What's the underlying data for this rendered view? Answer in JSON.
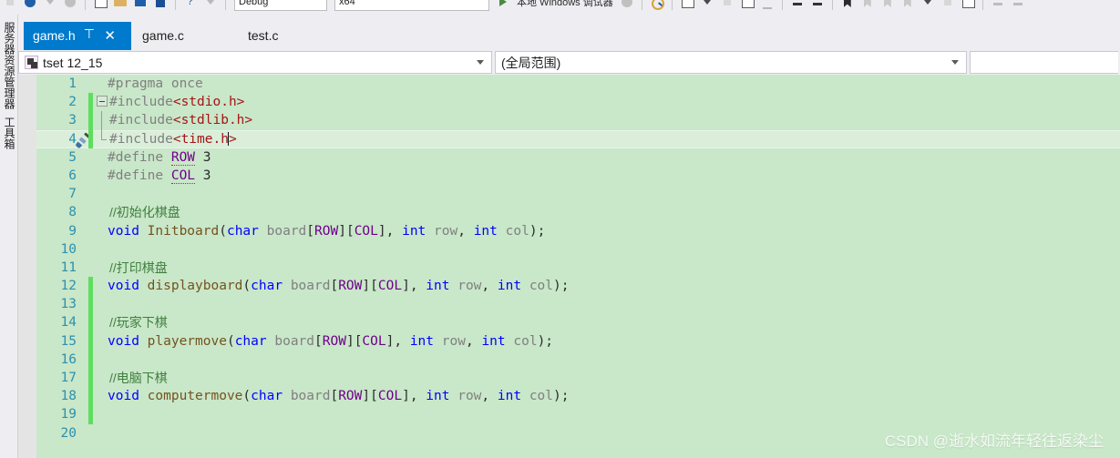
{
  "toolbar": {
    "config_value": "Debug",
    "platform_value": "x64",
    "run_label": "本地 Windows 调试器",
    "icons": [
      "back-arrow-icon",
      "forward-arrow-icon",
      "new-item-icon",
      "open-folder-icon",
      "save-icon",
      "save-all-icon",
      "undo-icon",
      "redo-icon",
      "start-debug-icon",
      "find-icon",
      "window-icon",
      "comment-icon",
      "uncomment-icon",
      "bookmark-icon",
      "bookmark-prev-icon",
      "bookmark-next-icon",
      "clear-bookmarks-icon"
    ]
  },
  "left_dock": {
    "items": [
      {
        "label": "服务器资源管理器",
        "name": "server-explorer"
      },
      {
        "label": "工具箱",
        "name": "toolbox"
      }
    ]
  },
  "tabs": [
    {
      "label": "game.h",
      "active": true,
      "pin": "⊤",
      "close": "✕"
    },
    {
      "label": "game.c",
      "active": false
    },
    {
      "label": "test.c",
      "active": false
    }
  ],
  "navbar": {
    "member_icon": "member-symbol-icon",
    "project_value": "tset 12_15",
    "scope_value": "(全局范围)",
    "third_value": "",
    "caret_icon": "chevron-down-icon"
  },
  "editor": {
    "language": "c-header",
    "current_line": 4,
    "line_numbers": [
      1,
      2,
      3,
      4,
      5,
      6,
      7,
      8,
      9,
      10,
      11,
      12,
      13,
      14,
      15,
      16,
      17,
      18,
      19,
      20
    ],
    "change_bar_lines": [
      2,
      3,
      4,
      12,
      13,
      14,
      15,
      16,
      17,
      18,
      19
    ],
    "fold_box_line": 2,
    "fold_line_range": [
      3,
      4
    ],
    "glyph_line_4": "brush-icon",
    "lines": [
      {
        "n": 1,
        "text": "#pragma once"
      },
      {
        "n": 2,
        "text": "#include<stdio.h>"
      },
      {
        "n": 3,
        "text": "#include<stdlib.h>"
      },
      {
        "n": 4,
        "text": "#include<time.h>"
      },
      {
        "n": 5,
        "text": "#define ROW 3"
      },
      {
        "n": 6,
        "text": "#define COL 3"
      },
      {
        "n": 7,
        "text": ""
      },
      {
        "n": 8,
        "text": "//初始化棋盘"
      },
      {
        "n": 9,
        "text": "void Initboard(char board[ROW][COL], int row, int col);"
      },
      {
        "n": 10,
        "text": ""
      },
      {
        "n": 11,
        "text": "//打印棋盘"
      },
      {
        "n": 12,
        "text": "void displayboard(char board[ROW][COL], int row, int col);"
      },
      {
        "n": 13,
        "text": ""
      },
      {
        "n": 14,
        "text": "//玩家下棋"
      },
      {
        "n": 15,
        "text": "void playermove(char board[ROW][COL], int row, int col);"
      },
      {
        "n": 16,
        "text": ""
      },
      {
        "n": 17,
        "text": "//电脑下棋"
      },
      {
        "n": 18,
        "text": "void computermove(char board[ROW][COL], int row, int col);"
      },
      {
        "n": 19,
        "text": ""
      },
      {
        "n": 20,
        "text": ""
      }
    ],
    "tokens": {
      "pragma_once": "#pragma once",
      "include": "#include",
      "inc_stdio": "<stdio.h>",
      "inc_stdlib": "<stdlib.h>",
      "inc_time_a": "<time.h",
      "inc_time_b": ">",
      "define": "#define",
      "row": "ROW",
      "col": "COL",
      "three": "3",
      "cmt_init": "//初始化棋盘",
      "cmt_print": "//打印棋盘",
      "cmt_player": "//玩家下棋",
      "cmt_computer": "//电脑下棋",
      "kw_void": "void",
      "kw_char": "char",
      "kw_int": "int",
      "fn_init": "Initboard",
      "fn_display": "displayboard",
      "fn_player": "playermove",
      "fn_computer": "computermove",
      "id_board": "board",
      "id_row": "row",
      "id_col": "col",
      "p_open": "(",
      "p_close": ");",
      "br_open": "[",
      "br_close": "]",
      "comma_sp": ", ",
      "sp": " "
    }
  },
  "watermark": {
    "text": "CSDN @逝水如流年轻往返染尘"
  },
  "colors": {
    "tab_active_bg": "#007acc",
    "editor_bg": "#c9e7c9",
    "current_line_bg": "#daeeda",
    "change_bar": "#5ede5e",
    "line_number": "#2b91af",
    "keyword": "#0000ff",
    "string": "#a31515",
    "preprocessor": "#808080",
    "macro": "#6f008a",
    "function": "#74531f",
    "comment": "#3f7f3f",
    "chrome_bg": "#eeeef2"
  }
}
